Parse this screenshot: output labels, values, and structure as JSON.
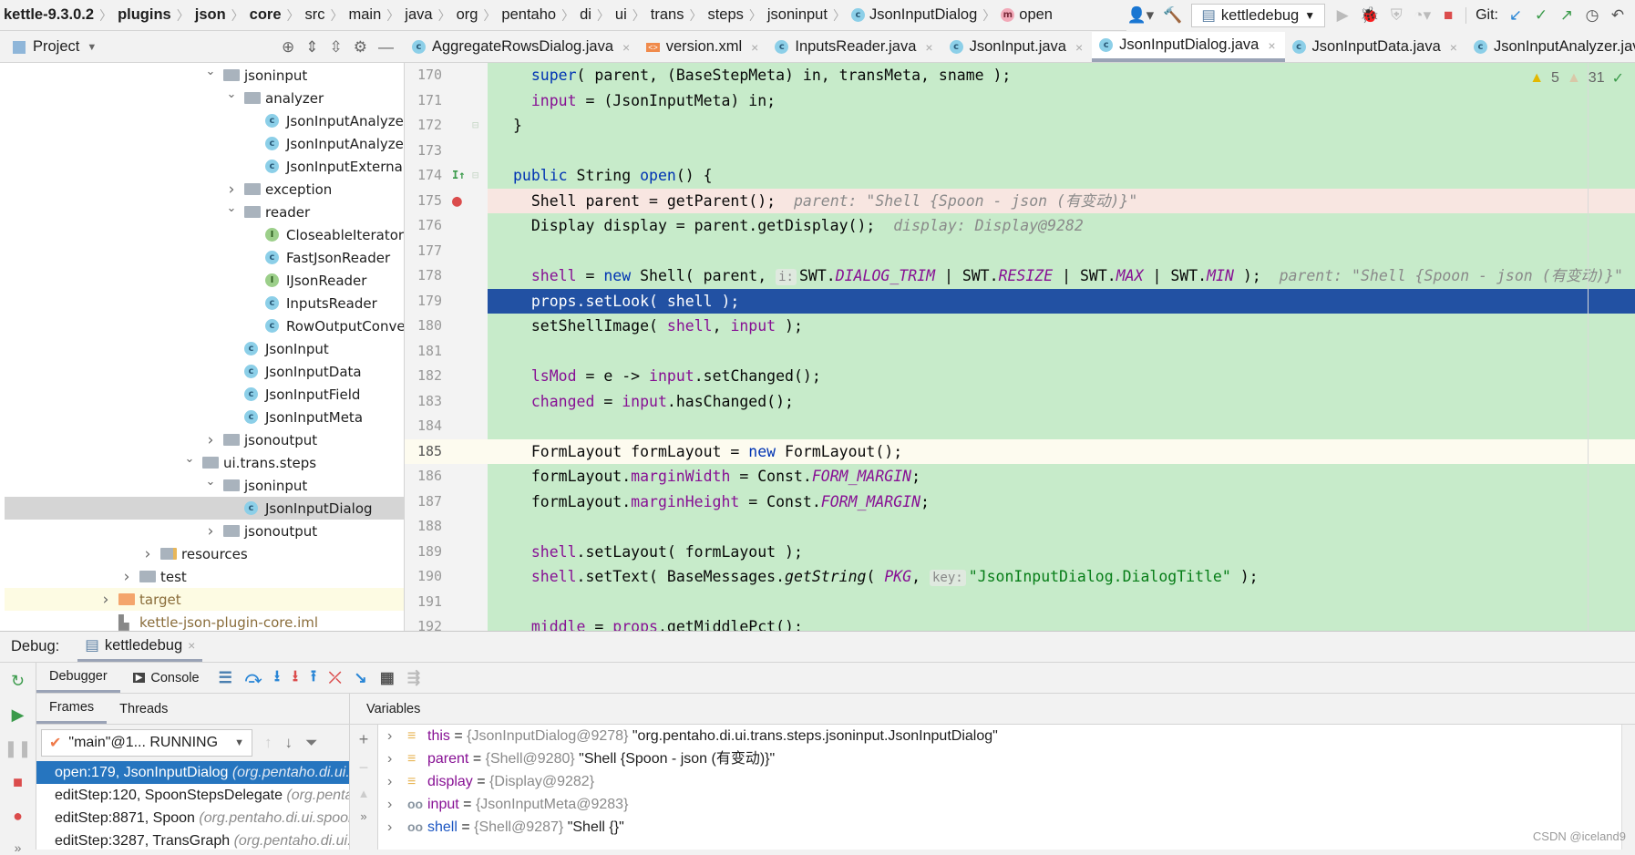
{
  "breadcrumb": [
    {
      "label": "kettle-9.3.0.2",
      "bold": true
    },
    {
      "label": "plugins",
      "bold": true
    },
    {
      "label": "json",
      "bold": true
    },
    {
      "label": "core",
      "bold": true
    },
    {
      "label": "src"
    },
    {
      "label": "main"
    },
    {
      "label": "java"
    },
    {
      "label": "org"
    },
    {
      "label": "pentaho"
    },
    {
      "label": "di"
    },
    {
      "label": "ui"
    },
    {
      "label": "trans"
    },
    {
      "label": "steps"
    },
    {
      "label": "jsoninput"
    },
    {
      "label": "JsonInputDialog",
      "icon": "class"
    },
    {
      "label": "open",
      "icon": "method"
    }
  ],
  "toolbar": {
    "run_config": "kettledebug",
    "git_label": "Git:"
  },
  "project_panel": {
    "title": "Project"
  },
  "tree": [
    {
      "depth": 5,
      "arrow": "open",
      "icon": "folder",
      "label": "jsoninput"
    },
    {
      "depth": 6,
      "arrow": "open",
      "icon": "folder",
      "label": "analyzer"
    },
    {
      "depth": 7,
      "icon": "class",
      "label": "JsonInputAnalyzer"
    },
    {
      "depth": 7,
      "icon": "class",
      "label": "JsonInputAnalyzerP"
    },
    {
      "depth": 7,
      "icon": "class",
      "label": "JsonInputExternalR"
    },
    {
      "depth": 6,
      "arrow": "closed",
      "icon": "folder",
      "label": "exception"
    },
    {
      "depth": 6,
      "arrow": "open",
      "icon": "folder",
      "label": "reader"
    },
    {
      "depth": 7,
      "icon": "interface",
      "label": "CloseableIterator"
    },
    {
      "depth": 7,
      "icon": "class",
      "label": "FastJsonReader"
    },
    {
      "depth": 7,
      "icon": "interface",
      "label": "IJsonReader"
    },
    {
      "depth": 7,
      "icon": "class",
      "label": "InputsReader"
    },
    {
      "depth": 7,
      "icon": "class",
      "label": "RowOutputConver"
    },
    {
      "depth": 6,
      "icon": "class",
      "label": "JsonInput"
    },
    {
      "depth": 6,
      "icon": "class",
      "label": "JsonInputData"
    },
    {
      "depth": 6,
      "icon": "class",
      "label": "JsonInputField"
    },
    {
      "depth": 6,
      "icon": "class",
      "label": "JsonInputMeta"
    },
    {
      "depth": 5,
      "arrow": "closed",
      "icon": "folder",
      "label": "jsonoutput"
    },
    {
      "depth": 4,
      "arrow": "open",
      "icon": "folder",
      "label": "ui.trans.steps"
    },
    {
      "depth": 5,
      "arrow": "open",
      "icon": "folder",
      "label": "jsoninput"
    },
    {
      "depth": 6,
      "icon": "class",
      "label": "JsonInputDialog",
      "selected": true
    },
    {
      "depth": 5,
      "arrow": "closed",
      "icon": "folder",
      "label": "jsonoutput"
    },
    {
      "depth": 2,
      "arrow": "closed",
      "icon": "resources-folder",
      "label": "resources"
    },
    {
      "depth": 1,
      "arrow": "closed",
      "icon": "folder",
      "label": "test"
    },
    {
      "depth": 0,
      "arrow": "closed",
      "icon": "orange-folder",
      "label": "target",
      "highlight": true
    },
    {
      "depth": 0,
      "icon": "iml-file",
      "label": "kettle-json-plugin-core.iml"
    }
  ],
  "editor_tabs": [
    {
      "label": "AggregateRowsDialog.java",
      "icon": "class"
    },
    {
      "label": "version.xml",
      "icon": "xml"
    },
    {
      "label": "InputsReader.java",
      "icon": "class"
    },
    {
      "label": "JsonInput.java",
      "icon": "class"
    },
    {
      "label": "JsonInputDialog.java",
      "icon": "class",
      "active": true
    },
    {
      "label": "JsonInputData.java",
      "icon": "class"
    },
    {
      "label": "JsonInputAnalyzer.java",
      "icon": "class"
    }
  ],
  "inspections": {
    "warnings": "5",
    "weak_warnings": "31"
  },
  "code": [
    {
      "n": "170",
      "t": [
        [
          "",
          "  "
        ],
        [
          "kw",
          "super"
        ],
        [
          "",
          "( parent, (BaseStepMeta) in, transMeta, sname );"
        ]
      ]
    },
    {
      "n": "171",
      "t": [
        [
          "",
          "  "
        ],
        [
          "fld",
          "input"
        ],
        [
          "",
          ": = (JsonInputMeta) in;"
        ]
      ]
    },
    {
      "n": "172",
      "fold": true,
      "t": [
        [
          "",
          "}"
        ]
      ]
    },
    {
      "n": "173",
      "t": []
    },
    {
      "n": "174",
      "impl": true,
      "fold": true,
      "t": [
        [
          "kw",
          "public"
        ],
        [
          "",
          " String "
        ],
        [
          "kw",
          "open"
        ],
        [
          "",
          "() {"
        ]
      ]
    },
    {
      "n": "175",
      "breakpoint": true,
      "t": [
        [
          "",
          "  Shell parent = getParent();  "
        ],
        [
          "hint",
          "parent: \"Shell {Spoon - json (有变动)}\""
        ]
      ]
    },
    {
      "n": "176",
      "t": [
        [
          "",
          "  Display display = parent.getDisplay();  "
        ],
        [
          "hint",
          "display: Display@9282"
        ]
      ]
    },
    {
      "n": "177",
      "t": []
    },
    {
      "n": "178",
      "t": [
        [
          "",
          "  "
        ],
        [
          "fld",
          "shell"
        ],
        [
          "",
          " = "
        ],
        [
          "kw",
          "new"
        ],
        [
          "",
          " Shell( parent, "
        ],
        [
          "ph",
          "i:"
        ],
        [
          "",
          "SWT."
        ],
        [
          "st",
          "DIALOG_TRIM"
        ],
        [
          "",
          " | SWT."
        ],
        [
          "st",
          "RESIZE"
        ],
        [
          "",
          " | SWT."
        ],
        [
          "st",
          "MAX"
        ],
        [
          "",
          " | SWT."
        ],
        [
          "st",
          "MIN"
        ],
        [
          "",
          " );  "
        ],
        [
          "hint",
          "parent: \"Shell {Spoon - json (有变动)}\""
        ]
      ]
    },
    {
      "n": "179",
      "exec": true,
      "t": [
        [
          "",
          "  props.setLook( shell );"
        ]
      ]
    },
    {
      "n": "180",
      "t": [
        [
          "",
          "  setShellImage( "
        ],
        [
          "fld",
          "shell"
        ],
        [
          "",
          ", "
        ],
        [
          "fld",
          "input"
        ],
        [
          "",
          " );"
        ]
      ]
    },
    {
      "n": "181",
      "t": []
    },
    {
      "n": "182",
      "t": [
        [
          "",
          "  "
        ],
        [
          "fld",
          "lsMod"
        ],
        [
          "",
          " = e -> "
        ],
        [
          "fld",
          "input"
        ],
        [
          "",
          ".setChanged();"
        ]
      ]
    },
    {
      "n": "183",
      "t": [
        [
          "",
          "  "
        ],
        [
          "fld",
          "changed"
        ],
        [
          "",
          " = "
        ],
        [
          "fld",
          "input"
        ],
        [
          "",
          ".hasChanged();"
        ]
      ]
    },
    {
      "n": "184",
      "t": []
    },
    {
      "n": "185",
      "current": true,
      "t": [
        [
          "",
          "  FormLayout formLayout = "
        ],
        [
          "kw",
          "new"
        ],
        [
          "",
          " FormLayout();"
        ]
      ]
    },
    {
      "n": "186",
      "t": [
        [
          "",
          "  formLayout."
        ],
        [
          "fld",
          "marginWidth"
        ],
        [
          "",
          " = Const."
        ],
        [
          "st",
          "FORM_MARGIN"
        ],
        [
          "",
          ";"
        ]
      ]
    },
    {
      "n": "187",
      "t": [
        [
          "",
          "  formLayout."
        ],
        [
          "fld",
          "marginHeight"
        ],
        [
          "",
          " = Const."
        ],
        [
          "st",
          "FORM_MARGIN"
        ],
        [
          "",
          ";"
        ]
      ]
    },
    {
      "n": "188",
      "t": []
    },
    {
      "n": "189",
      "t": [
        [
          "",
          "  "
        ],
        [
          "fld",
          "shell"
        ],
        [
          "",
          ".setLayout( formLayout );"
        ]
      ]
    },
    {
      "n": "190",
      "t": [
        [
          "",
          "  "
        ],
        [
          "fld",
          "shell"
        ],
        [
          "",
          ".setText( BaseMessages."
        ],
        [
          "it",
          "getString"
        ],
        [
          "",
          "( "
        ],
        [
          "st",
          "PKG"
        ],
        [
          "",
          ", "
        ],
        [
          "ph",
          "key:"
        ],
        [
          "str",
          "\"JsonInputDialog.DialogTitle\""
        ],
        [
          "",
          " );"
        ]
      ]
    },
    {
      "n": "191",
      "t": []
    },
    {
      "n": "192",
      "t": [
        [
          "",
          "  "
        ],
        [
          "fld",
          "middle"
        ],
        [
          "",
          " = "
        ],
        [
          "fld",
          "props"
        ],
        [
          "",
          ".getMiddlePct();"
        ]
      ]
    }
  ],
  "debug": {
    "label": "Debug:",
    "session": "kettledebug",
    "tabs": {
      "debugger": "Debugger",
      "console": "Console"
    },
    "frames_tab": "Frames",
    "threads_tab": "Threads",
    "variables_title": "Variables",
    "thread_selector": "\"main\"@1... RUNNING",
    "frames": [
      {
        "method": "open:179, JsonInputDialog",
        "pkg": "(org.pentaho.di.ui.trans.steps.jsoninput)",
        "selected": true
      },
      {
        "method": "editStep:120, SpoonStepsDelegate",
        "pkg": "(org.pentaho.di.ui.spoon.delegates)"
      },
      {
        "method": "editStep:8871, Spoon",
        "pkg": "(org.pentaho.di.ui.spoon)"
      },
      {
        "method": "editStep:3287, TransGraph",
        "pkg": "(org.pentaho.di.ui.spoon.trans)"
      }
    ],
    "variables": [
      {
        "icon": "field",
        "name": "this",
        "type": "{JsonInputDialog@9278}",
        "value": "\"org.pentaho.di.ui.trans.steps.jsoninput.JsonInputDialog\""
      },
      {
        "icon": "field",
        "name": "parent",
        "type": "{Shell@9280}",
        "value": "\"Shell {Spoon - json (有变动)}\""
      },
      {
        "icon": "field",
        "name": "display",
        "type": "{Display@9282}",
        "value": ""
      },
      {
        "icon": "watch",
        "name": "input",
        "type": "{JsonInputMeta@9283}",
        "value": ""
      },
      {
        "icon": "watch",
        "name": "shell",
        "type": "{Shell@9287}",
        "value": "\"Shell {}\"",
        "blue": true
      }
    ]
  },
  "watermark": "CSDN @iceland9",
  "colors": {
    "changed_bg": "#c7ebca",
    "exec_line": "#2251a3",
    "breakpoint_line": "#f8e6e1",
    "selected_frame": "#2675bf"
  }
}
